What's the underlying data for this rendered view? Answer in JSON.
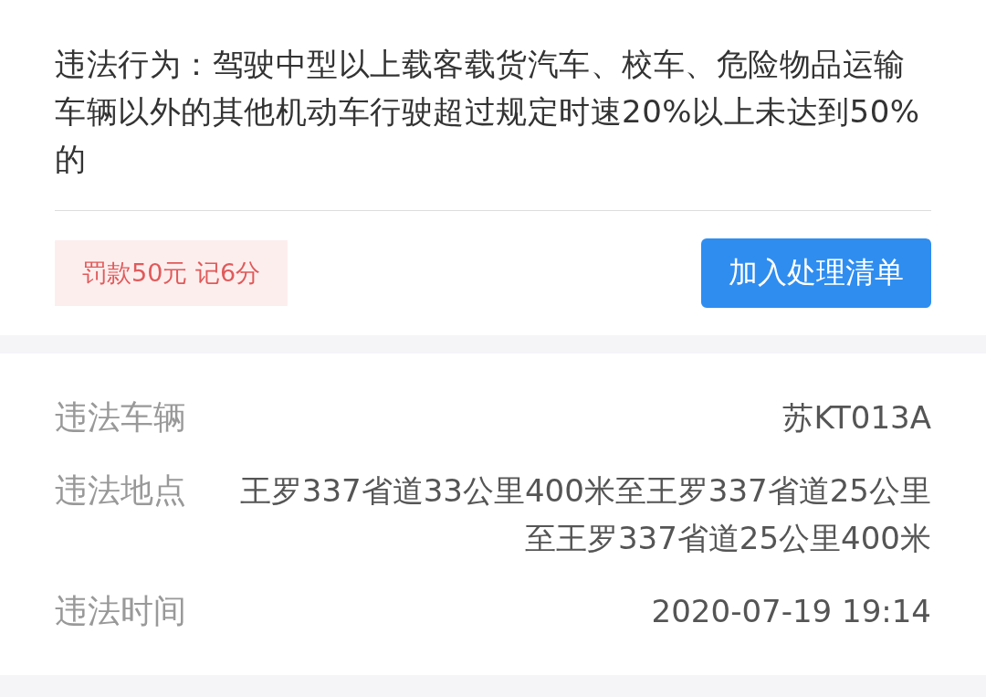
{
  "violation": {
    "label": "违法行为：",
    "text": "驾驶中型以上载客载货汽车、校车、危险物品运输车辆以外的其他机动车行驶超过规定时速20%以上未达到50%的"
  },
  "penalty": "罚款50元 记6分",
  "action_button": "加入处理清单",
  "details": [
    {
      "label": "违法车辆",
      "value": "苏KT013A"
    },
    {
      "label": "违法地点",
      "value": "王罗337省道33公里400米至王罗337省道25公里至王罗337省道25公里400米"
    },
    {
      "label": "违法时间",
      "value": "2020-07-19 19:14"
    }
  ]
}
